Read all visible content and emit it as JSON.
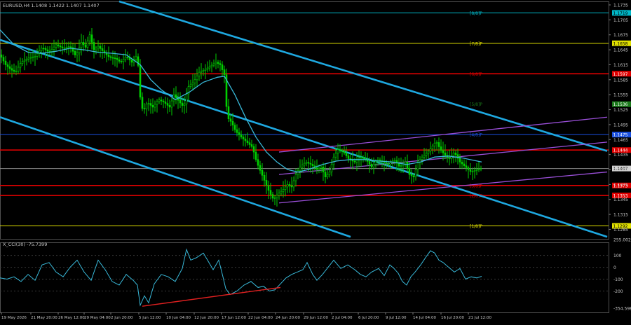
{
  "header": {
    "symbol_line": "EURUSD,H4  1.1408 1.1422 1.1407 1.1407"
  },
  "indicator": {
    "label": "X_CCI(30) -75.7399"
  },
  "colors": {
    "background": "#000000",
    "candle": "#00d000",
    "ma": "#38b8d8",
    "channel": "#1ea8e0",
    "regression": "#9a4fd8",
    "cci": "#38b8d8",
    "divergence": "#e02020",
    "text": "#c8c8c8"
  },
  "chart_data": [
    {
      "type": "candlestick",
      "symbol": "EURUSD",
      "timeframe": "H4",
      "ylim": [
        1.1266,
        1.1742
      ],
      "price_ticks": [
        "1.1735",
        "1.1705",
        "1.1675",
        "1.1645",
        "1.1615",
        "1.1585",
        "1.1555",
        "1.1525",
        "1.1495",
        "1.1465",
        "1.1435",
        "1.1405",
        "1.1375",
        "1.1345",
        "1.1315",
        "1.1285"
      ],
      "x_labels": [
        "19 May 2026",
        "21 May 20:00",
        "26 May 12:00",
        "29 May 04:00",
        "2 Jun 20:00",
        "5 Jun 12:00",
        "10 Jun 04:00",
        "12 Jun 20:00",
        "17 Jun 12:00",
        "22 Jun 04:00",
        "24 Jun 20:00",
        "29 Jun 12:00",
        "2 Jul 04:00",
        "6 Jul 20:00",
        "9 Jul 12:00",
        "14 Jul 04:00",
        "16 Jul 20:00",
        "21 Jul 12:00"
      ],
      "close_path": [
        [
          0,
          1.1635
        ],
        [
          8,
          1.1615
        ],
        [
          16,
          1.1605
        ],
        [
          22,
          1.16
        ],
        [
          30,
          1.162
        ],
        [
          40,
          1.1628
        ],
        [
          50,
          1.1632
        ],
        [
          60,
          1.165
        ],
        [
          70,
          1.164
        ],
        [
          80,
          1.1655
        ],
        [
          90,
          1.1648
        ],
        [
          100,
          1.1652
        ],
        [
          108,
          1.1632
        ],
        [
          116,
          1.166
        ],
        [
          122,
          1.165
        ],
        [
          128,
          1.1675
        ],
        [
          134,
          1.1645
        ],
        [
          140,
          1.1652
        ],
        [
          148,
          1.164
        ],
        [
          156,
          1.163
        ],
        [
          164,
          1.1628
        ],
        [
          172,
          1.162
        ],
        [
          180,
          1.1632
        ],
        [
          188,
          1.162
        ],
        [
          196,
          1.1635
        ],
        [
          200,
          1.155
        ],
        [
          204,
          1.152
        ],
        [
          210,
          1.154
        ],
        [
          218,
          1.153
        ],
        [
          226,
          1.1545
        ],
        [
          234,
          1.154
        ],
        [
          242,
          1.153
        ],
        [
          248,
          1.1555
        ],
        [
          256,
          1.154
        ],
        [
          262,
          1.153
        ],
        [
          268,
          1.157
        ],
        [
          276,
          1.158
        ],
        [
          284,
          1.16
        ],
        [
          292,
          1.1605
        ],
        [
          300,
          1.1612
        ],
        [
          308,
          1.162
        ],
        [
          314,
          1.1615
        ],
        [
          320,
          1.1595
        ],
        [
          324,
          1.151
        ],
        [
          330,
          1.15
        ],
        [
          336,
          1.1482
        ],
        [
          344,
          1.147
        ],
        [
          352,
          1.146
        ],
        [
          360,
          1.145
        ],
        [
          366,
          1.142
        ],
        [
          372,
          1.14
        ],
        [
          378,
          1.138
        ],
        [
          384,
          1.136
        ],
        [
          390,
          1.1345
        ],
        [
          396,
          1.1355
        ],
        [
          404,
          1.1365
        ],
        [
          410,
          1.1375
        ],
        [
          416,
          1.137
        ],
        [
          422,
          1.1395
        ],
        [
          428,
          1.141
        ],
        [
          436,
          1.142
        ],
        [
          444,
          1.1415
        ],
        [
          452,
          1.1405
        ],
        [
          458,
          1.141
        ],
        [
          464,
          1.139
        ],
        [
          470,
          1.14
        ],
        [
          476,
          1.143
        ],
        [
          482,
          1.1445
        ],
        [
          490,
          1.144
        ],
        [
          498,
          1.1425
        ],
        [
          506,
          1.142
        ],
        [
          514,
          1.143
        ],
        [
          522,
          1.1425
        ],
        [
          530,
          1.141
        ],
        [
          538,
          1.1425
        ],
        [
          546,
          1.142
        ],
        [
          554,
          1.1415
        ],
        [
          562,
          1.1425
        ],
        [
          570,
          1.141
        ],
        [
          578,
          1.142
        ],
        [
          584,
          1.1395
        ],
        [
          590,
          1.139
        ],
        [
          596,
          1.142
        ],
        [
          602,
          1.143
        ],
        [
          610,
          1.144
        ],
        [
          616,
          1.145
        ],
        [
          622,
          1.1462
        ],
        [
          628,
          1.1445
        ],
        [
          634,
          1.1435
        ],
        [
          640,
          1.1425
        ],
        [
          648,
          1.144
        ],
        [
          656,
          1.142
        ],
        [
          664,
          1.141
        ],
        [
          672,
          1.14
        ],
        [
          680,
          1.1405
        ],
        [
          687,
          1.1407
        ]
      ],
      "ma_path": [
        [
          0,
          1.1685
        ],
        [
          20,
          1.1655
        ],
        [
          40,
          1.164
        ],
        [
          60,
          1.1638
        ],
        [
          80,
          1.1642
        ],
        [
          100,
          1.1648
        ],
        [
          120,
          1.1645
        ],
        [
          140,
          1.164
        ],
        [
          160,
          1.1638
        ],
        [
          180,
          1.1635
        ],
        [
          200,
          1.1615
        ],
        [
          215,
          1.1585
        ],
        [
          230,
          1.1565
        ],
        [
          250,
          1.1545
        ],
        [
          270,
          1.156
        ],
        [
          290,
          1.158
        ],
        [
          310,
          1.159
        ],
        [
          320,
          1.1592
        ],
        [
          335,
          1.1555
        ],
        [
          350,
          1.151
        ],
        [
          365,
          1.147
        ],
        [
          380,
          1.144
        ],
        [
          395,
          1.142
        ],
        [
          410,
          1.1405
        ],
        [
          425,
          1.14
        ],
        [
          440,
          1.1405
        ],
        [
          460,
          1.1415
        ],
        [
          480,
          1.1422
        ],
        [
          500,
          1.1425
        ],
        [
          520,
          1.1425
        ],
        [
          540,
          1.1422
        ],
        [
          560,
          1.142
        ],
        [
          580,
          1.1415
        ],
        [
          600,
          1.142
        ],
        [
          620,
          1.143
        ],
        [
          640,
          1.1432
        ],
        [
          660,
          1.1428
        ],
        [
          687,
          1.142
        ]
      ],
      "murrey_levels": [
        {
          "label": "[8/8]P",
          "price": 1.1719,
          "badge": "1.1719",
          "line": "#00b8c8",
          "badge_color": "#00b8c8"
        },
        {
          "label": "[7/8]P",
          "price": 1.1658,
          "badge": "1.1658",
          "line": "#e0e000",
          "badge_color": "#e0e000"
        },
        {
          "label": "[6/8]P",
          "price": 1.1597,
          "badge": "1.1597",
          "line": "#e00000",
          "badge_color": "#e00000"
        },
        {
          "label": "[5/8]P",
          "price": 1.1536,
          "badge": "1.1536",
          "line": "none",
          "badge_color": "#1a7a1a"
        },
        {
          "label": "[4/8]P",
          "price": 1.1475,
          "badge": "1.1475",
          "line": "#1a50e0",
          "badge_color": "#1a50e0"
        },
        {
          "label": "",
          "price": 1.1444,
          "badge": "1.1444",
          "line": "#e00000",
          "badge_color": "#e00000"
        },
        {
          "label": "",
          "price": 1.1407,
          "badge": "1.1407",
          "line": "#8a8a8a",
          "badge_color": "#d0d0d0"
        },
        {
          "label": "[3/8]P",
          "price": 1.1373,
          "badge": "1.1373",
          "line": "#e00000",
          "badge_color": "#e00000"
        },
        {
          "label": "[2/8]P",
          "price": 1.1353,
          "badge": "1.1353",
          "line": "#e00000",
          "badge_color": "#e00000"
        },
        {
          "label": "[1/8]P",
          "price": 1.1292,
          "badge": "1.1292",
          "line": "#e0e000",
          "badge_color": "#e0e000"
        }
      ],
      "channel_lines": [
        [
          [
            170,
            1.1742
          ],
          [
            866,
            1.1442
          ]
        ],
        [
          [
            0,
            1.1665
          ],
          [
            866,
            1.127
          ]
        ],
        [
          [
            0,
            1.151
          ],
          [
            500,
            1.127
          ]
        ]
      ],
      "regression_lines": [
        [
          [
            398,
            1.144
          ],
          [
            866,
            1.151
          ]
        ],
        [
          [
            398,
            1.1395
          ],
          [
            866,
            1.146
          ]
        ],
        [
          [
            398,
            1.1338
          ],
          [
            866,
            1.14
          ]
        ]
      ]
    },
    {
      "type": "line",
      "name": "X_CCI(30)",
      "ylim": [
        -380,
        210
      ],
      "ticks": [
        "255.0021",
        "100",
        "0",
        "-100",
        "-200",
        "-354.5983"
      ],
      "cci_path": [
        [
          0,
          -90
        ],
        [
          10,
          -100
        ],
        [
          20,
          -80
        ],
        [
          30,
          -120
        ],
        [
          40,
          -60
        ],
        [
          50,
          -110
        ],
        [
          60,
          20
        ],
        [
          70,
          40
        ],
        [
          80,
          -40
        ],
        [
          90,
          -80
        ],
        [
          100,
          0
        ],
        [
          110,
          60
        ],
        [
          120,
          -40
        ],
        [
          130,
          -110
        ],
        [
          140,
          60
        ],
        [
          150,
          -20
        ],
        [
          160,
          -120
        ],
        [
          170,
          -150
        ],
        [
          180,
          -60
        ],
        [
          190,
          -110
        ],
        [
          196,
          -150
        ],
        [
          200,
          -320
        ],
        [
          206,
          -240
        ],
        [
          212,
          -300
        ],
        [
          220,
          -140
        ],
        [
          230,
          -60
        ],
        [
          240,
          -80
        ],
        [
          250,
          -120
        ],
        [
          260,
          -10
        ],
        [
          266,
          150
        ],
        [
          272,
          60
        ],
        [
          280,
          80
        ],
        [
          290,
          120
        ],
        [
          296,
          60
        ],
        [
          304,
          -20
        ],
        [
          312,
          60
        ],
        [
          318,
          -80
        ],
        [
          322,
          -180
        ],
        [
          328,
          -230
        ],
        [
          338,
          -200
        ],
        [
          348,
          -150
        ],
        [
          358,
          -120
        ],
        [
          368,
          -170
        ],
        [
          376,
          -160
        ],
        [
          384,
          -200
        ],
        [
          392,
          -190
        ],
        [
          400,
          -140
        ],
        [
          408,
          -90
        ],
        [
          416,
          -60
        ],
        [
          424,
          -40
        ],
        [
          432,
          -20
        ],
        [
          438,
          40
        ],
        [
          446,
          -60
        ],
        [
          452,
          -110
        ],
        [
          460,
          -60
        ],
        [
          468,
          0
        ],
        [
          476,
          60
        ],
        [
          486,
          -10
        ],
        [
          496,
          20
        ],
        [
          506,
          -20
        ],
        [
          514,
          -60
        ],
        [
          522,
          -80
        ],
        [
          530,
          -40
        ],
        [
          540,
          -10
        ],
        [
          548,
          -70
        ],
        [
          556,
          20
        ],
        [
          562,
          -10
        ],
        [
          568,
          -50
        ],
        [
          574,
          -120
        ],
        [
          580,
          -150
        ],
        [
          586,
          -80
        ],
        [
          592,
          -40
        ],
        [
          600,
          20
        ],
        [
          608,
          90
        ],
        [
          614,
          140
        ],
        [
          620,
          120
        ],
        [
          626,
          60
        ],
        [
          632,
          40
        ],
        [
          640,
          0
        ],
        [
          648,
          -40
        ],
        [
          656,
          -10
        ],
        [
          664,
          -100
        ],
        [
          672,
          -80
        ],
        [
          680,
          -90
        ],
        [
          687,
          -76
        ]
      ],
      "divergence_line": [
        [
          203,
          -328
        ],
        [
          400,
          -170
        ]
      ]
    }
  ]
}
